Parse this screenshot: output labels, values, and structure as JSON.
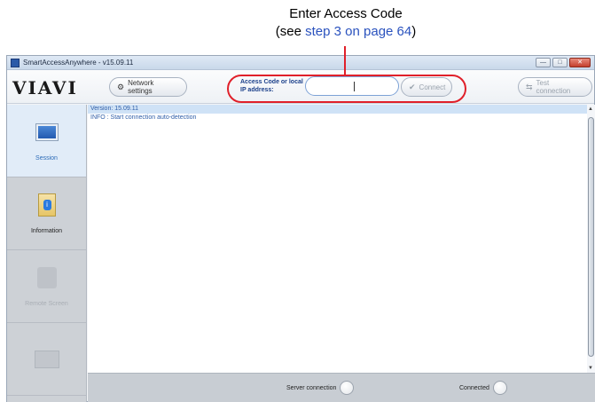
{
  "annotation": {
    "line1": "Enter Access Code",
    "line2_prefix": "(see ",
    "line2_link": "step 3 on page 64",
    "line2_suffix": ")"
  },
  "window": {
    "title": "SmartAccessAnywhere - v15.09.11",
    "controls": {
      "minimize": "—",
      "maximize": "□",
      "close": "✕"
    }
  },
  "toolbar": {
    "logo": "VIAVI",
    "network_settings": "Network settings",
    "access_label_line1": "Access Code or local",
    "access_label_line2": "IP address:",
    "access_value": "",
    "connect": "Connect",
    "test_connection": "Test connection"
  },
  "sidebar": {
    "items": [
      {
        "label": "Session",
        "state": "active",
        "icon": "monitor-icon"
      },
      {
        "label": "Information",
        "state": "enabled",
        "icon": "info-icon"
      },
      {
        "label": "Remote Screen",
        "state": "disabled",
        "icon": "remote-screen-icon"
      },
      {
        "label": "",
        "state": "disabled",
        "icon": "box-icon"
      }
    ]
  },
  "log": {
    "lines": [
      "Version: 15.09.11",
      "INFO : Start connection auto-detection"
    ]
  },
  "status": {
    "server_connection": "Server connection",
    "connected": "Connected"
  },
  "colors": {
    "callout": "#e0202a",
    "link": "#2a52be",
    "log_text": "#2f5ea8",
    "sidebar_bg": "#cdd1d6"
  }
}
